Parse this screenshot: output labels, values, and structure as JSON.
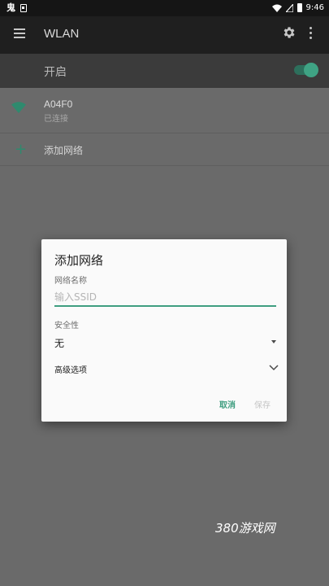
{
  "status_bar": {
    "notification_glyph": "鬼",
    "time": "9:46"
  },
  "app_bar": {
    "title": "WLAN"
  },
  "master_switch": {
    "label": "开启",
    "on": true
  },
  "networks": [
    {
      "ssid": "A04F0",
      "status": "已连接"
    }
  ],
  "add_network_label": "添加网络",
  "dialog": {
    "title": "添加网络",
    "ssid_label": "网络名称",
    "ssid_placeholder": "输入SSID",
    "ssid_value": "",
    "security_label": "安全性",
    "security_value": "无",
    "advanced_label": "高级选项",
    "cancel_label": "取消",
    "save_label": "保存"
  },
  "watermark": "380游戏网",
  "colors": {
    "accent": "#3f9e80",
    "app_bar": "#1f1f1f",
    "scrim": "#6a6a6a"
  }
}
